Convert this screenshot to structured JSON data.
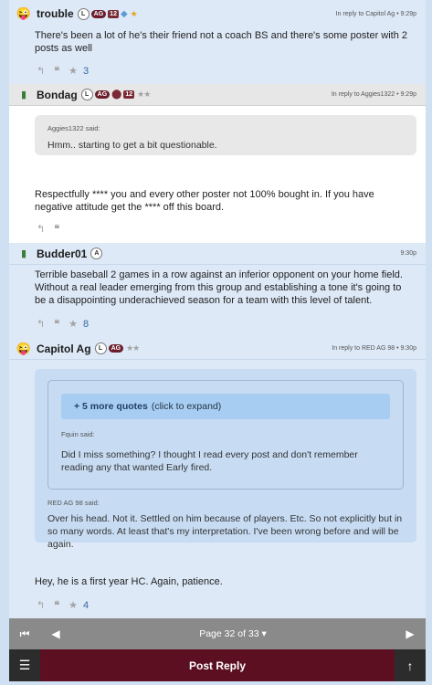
{
  "posts": [
    {
      "username": "trouble",
      "badges": {
        "l": "L",
        "ag": "AG",
        "num": "12"
      },
      "meta": "In reply to Capitol Ag • 9:29p",
      "body": "There's been a lot of he's their friend not a coach BS and there's some poster with 2 posts as well",
      "star_count": "3",
      "avatar": "emoji-face-icon"
    },
    {
      "username": "Bondag",
      "badges": {
        "l": "L",
        "ag": "AG",
        "num": "12"
      },
      "meta": "In reply to Aggies1322 • 9:29p",
      "quote_author": "Aggies1322 said:",
      "quote_text": "Hmm.. starting to get a bit questionable.",
      "body": "Respectfully **** you and every other poster not 100% bought in. If you have negative attitude get the **** off this board.",
      "avatar": "phone-icon"
    },
    {
      "username": "Budder01",
      "badges": {
        "a": "A"
      },
      "meta": "9:30p",
      "body": "Terrible baseball 2 games in a row against an inferior opponent on your home field. Without a real leader emerging from this group and establishing a tone it's going to be a disappointing underachieved season for a team with this level of talent.",
      "star_count": "8",
      "avatar": "phone-icon"
    },
    {
      "username": "Capitol Ag",
      "badges": {
        "l": "L",
        "ag": "AG"
      },
      "meta": "In reply to RED AG 98 • 9:30p",
      "more_quotes_bold": "+ 5 more quotes",
      "more_quotes_rest": "(click to expand)",
      "inner_quote_author": "Fquin said:",
      "inner_quote_text": "Did I miss something? I thought I read every post and don't remember reading any that wanted Early fired.",
      "outer_quote_author": "RED AG 98 said:",
      "outer_quote_text": "Over his head. Not it. Settled on him because of players. Etc. So not explicitly but in so many words. At least that's my interpretation. I've been wrong before and will be again.",
      "body": "Hey, he is a first year HC. Again, patience.",
      "star_count": "4",
      "avatar": "emoji-face-icon"
    }
  ],
  "pager": {
    "label": "Page 32 of 33 ▾"
  },
  "reply_bar": {
    "label": "Post Reply"
  },
  "colors": {
    "accent": "#5b0f21",
    "post_bg": "#dde9f7",
    "post_bg_alt": "#ffffff"
  }
}
